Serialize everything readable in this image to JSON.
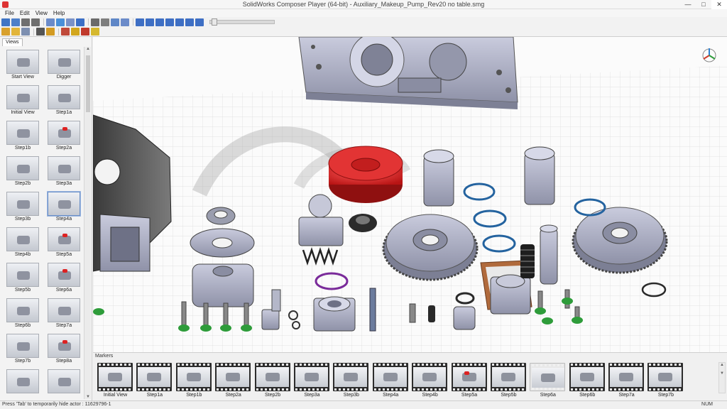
{
  "window": {
    "title": "SolidWorks Composer Player (64-bit) - Auxiliary_Makeup_Pump_Rev20 no table.smg",
    "controls": {
      "minimize": "—",
      "maximize": "□",
      "close": "✕"
    }
  },
  "menu": [
    "File",
    "Edit",
    "View",
    "Help"
  ],
  "toolbar1": {
    "buttons": [
      {
        "icon": "open-icon",
        "color": "#3f74c4"
      },
      {
        "icon": "save-icon",
        "color": "#4d7fc9"
      },
      {
        "icon": "undo-icon",
        "color": "#6f6f6f"
      },
      {
        "icon": "redo-icon",
        "color": "#6f6f6f"
      },
      {
        "icon": "print-icon",
        "color": "#6b8bc9"
      },
      {
        "icon": "properties-icon",
        "color": "#4a90d9"
      },
      {
        "icon": "grid-icon",
        "color": "#7a92c8"
      },
      {
        "icon": "info-icon",
        "color": "#3b6fc6"
      },
      {
        "icon": "layout-icon",
        "color": "#6a6a6a"
      },
      {
        "icon": "zoom-fit-icon",
        "color": "#7e7e7e"
      },
      {
        "icon": "view-icon",
        "color": "#5f87c7"
      },
      {
        "icon": "camera-icon",
        "color": "#6b8bc9"
      }
    ],
    "playback": [
      {
        "icon": "first-frame-icon",
        "color": "#3e6fc4"
      },
      {
        "icon": "prev-frame-icon",
        "color": "#3e6fc4"
      },
      {
        "icon": "play-icon",
        "color": "#3e6fc4"
      },
      {
        "icon": "pause-icon",
        "color": "#3e6fc4"
      },
      {
        "icon": "stop-icon",
        "color": "#3e6fc4"
      },
      {
        "icon": "next-frame-icon",
        "color": "#3e6fc4"
      },
      {
        "icon": "last-frame-icon",
        "color": "#3e6fc4"
      }
    ]
  },
  "toolbar2": {
    "buttons": [
      {
        "icon": "paint-icon",
        "color": "#d8a02c"
      },
      {
        "icon": "light-icon",
        "color": "#e2b53b"
      },
      {
        "icon": "render-mode-icon",
        "color": "#7d8fb0"
      },
      {
        "icon": "move-icon",
        "color": "#555555"
      },
      {
        "icon": "select-icon",
        "color": "#d39b23"
      },
      {
        "icon": "measure-icon",
        "color": "#c04a3a"
      },
      {
        "icon": "annotation-icon",
        "color": "#d2a61d"
      },
      {
        "icon": "markup-icon",
        "color": "#c0392b"
      },
      {
        "icon": "shape-icon",
        "color": "#d5b82f"
      }
    ]
  },
  "views_panel": {
    "tab": "Views",
    "items": [
      {
        "label": "Start View",
        "red": false,
        "selected": false
      },
      {
        "label": "Digger",
        "red": false,
        "selected": false
      },
      {
        "label": "Initial View",
        "red": false,
        "selected": false
      },
      {
        "label": "Step1a",
        "red": false,
        "selected": false
      },
      {
        "label": "Step1b",
        "red": false,
        "selected": false
      },
      {
        "label": "Step2a",
        "red": true,
        "selected": false
      },
      {
        "label": "Step2b",
        "red": false,
        "selected": false
      },
      {
        "label": "Step3a",
        "red": false,
        "selected": false
      },
      {
        "label": "Step3b",
        "red": false,
        "selected": false
      },
      {
        "label": "Step4a",
        "red": false,
        "selected": true
      },
      {
        "label": "Step4b",
        "red": false,
        "selected": false
      },
      {
        "label": "Step5a",
        "red": true,
        "selected": false
      },
      {
        "label": "Step5b",
        "red": false,
        "selected": false
      },
      {
        "label": "Step6a",
        "red": true,
        "selected": false
      },
      {
        "label": "Step6b",
        "red": false,
        "selected": false
      },
      {
        "label": "Step7a",
        "red": false,
        "selected": false
      },
      {
        "label": "Step7b",
        "red": false,
        "selected": false
      },
      {
        "label": "Step8a",
        "red": true,
        "selected": false
      },
      {
        "label": "",
        "red": false,
        "selected": false
      },
      {
        "label": "",
        "red": false,
        "selected": false
      }
    ]
  },
  "markers": {
    "label": "Markers",
    "items": [
      {
        "label": "Initial View",
        "red": false,
        "selected": false
      },
      {
        "label": "Step1a",
        "red": false,
        "selected": false
      },
      {
        "label": "Step1b",
        "red": false,
        "selected": false
      },
      {
        "label": "Step2a",
        "red": false,
        "selected": false
      },
      {
        "label": "Step2b",
        "red": false,
        "selected": false
      },
      {
        "label": "Step3a",
        "red": false,
        "selected": false
      },
      {
        "label": "Step3b",
        "red": false,
        "selected": false
      },
      {
        "label": "Step4a",
        "red": false,
        "selected": false
      },
      {
        "label": "Step4b",
        "red": false,
        "selected": false
      },
      {
        "label": "Step5a",
        "red": true,
        "selected": false
      },
      {
        "label": "Step5b",
        "red": false,
        "selected": false
      },
      {
        "label": "Step6a",
        "red": false,
        "selected": true
      },
      {
        "label": "Step6b",
        "red": false,
        "selected": false
      },
      {
        "label": "Step7a",
        "red": false,
        "selected": false
      },
      {
        "label": "Step7b",
        "red": false,
        "selected": false
      }
    ]
  },
  "status": {
    "text": "Press 'Tab' to temporarily hide actor : 11629796-1",
    "num": "NUM"
  },
  "colors": {
    "part_gray": "#a9acc1",
    "part_red": "#d41f1f",
    "seal_blue": "#24639f",
    "green_ring": "#2e9c3a",
    "orange_gasket": "#b06a3c",
    "purple_ring": "#7a2b9a"
  }
}
